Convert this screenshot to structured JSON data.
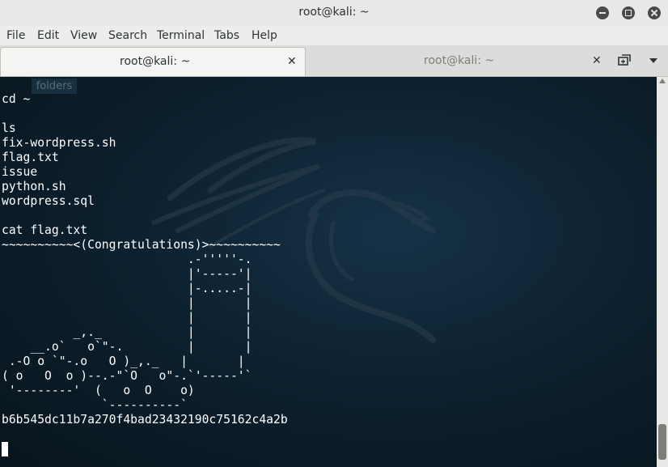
{
  "window": {
    "title": "root@kali: ~"
  },
  "menu": [
    "File",
    "Edit",
    "View",
    "Search",
    "Terminal",
    "Tabs",
    "Help"
  ],
  "tabs": [
    {
      "label": "root@kali: ~",
      "active": true
    },
    {
      "label": "root@kali: ~",
      "active": false
    }
  ],
  "tab_close_glyph": "✕",
  "tooltip": "folders",
  "terminal": {
    "lines": [
      "cd ~",
      "",
      "ls",
      "fix-wordpress.sh",
      "flag.txt",
      "issue",
      "python.sh",
      "wordpress.sql",
      "",
      "cat flag.txt",
      "~~~~~~~~~~<(Congratulations)>~~~~~~~~~~",
      "                          .-'''''-.",
      "                          |'-----'|",
      "                          |-.....-|",
      "                          |       |",
      "                          |       |",
      "          _,._            |       |",
      "    __.o`   o`\"-.         |       |",
      " .-O o `\"-.o   O )_,._   |       |",
      "( o   O  o )--.-\"`O   o\"-.`'-----'`",
      " '--------'  (   o  O    o)",
      "              `----------`",
      "b6b545dc11b7a270f4bad23432190c75162c4a2b",
      ""
    ]
  },
  "colors": {
    "terminal_bg": "#0d2130",
    "terminal_fg": "#ffffff",
    "chrome_bg": "#e8e8e7"
  },
  "icons": [
    "minimize-icon",
    "maximize-icon",
    "close-icon",
    "new-tab-icon",
    "tab-menu-icon",
    "dragon-logo"
  ]
}
